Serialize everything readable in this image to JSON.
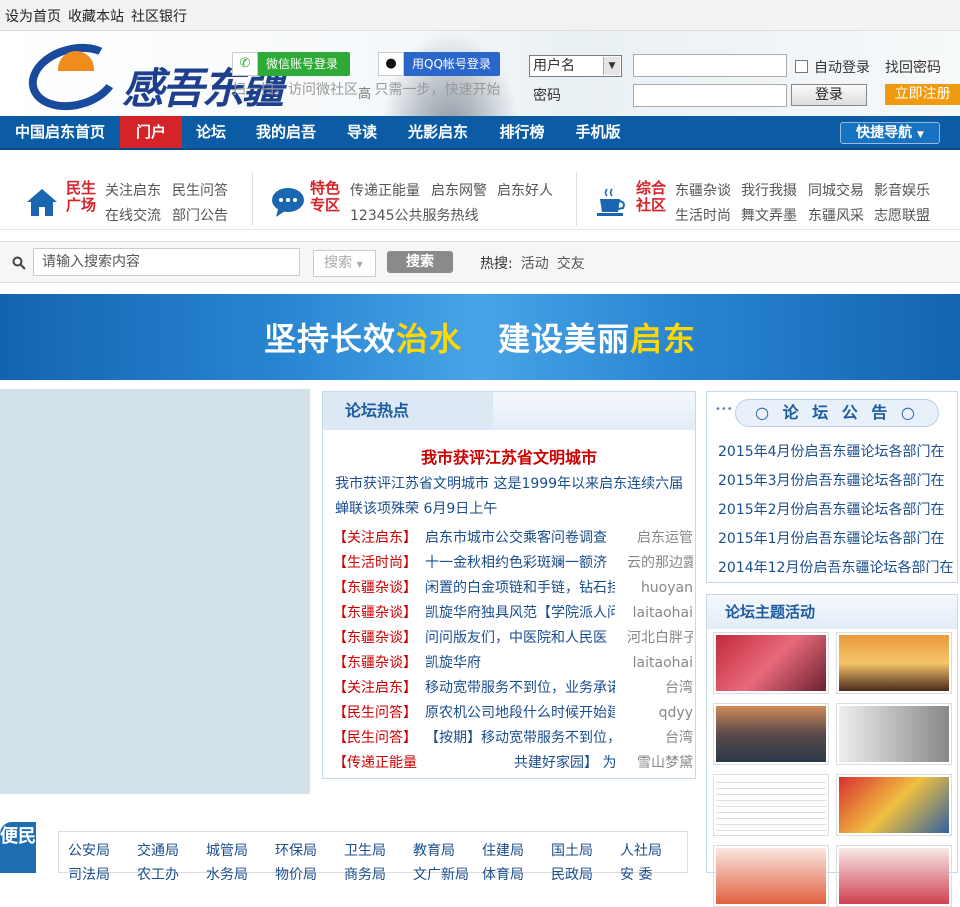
{
  "topbar": {
    "set_home": "设为首页",
    "bookmark": "收藏本站",
    "community_bank": "社区银行"
  },
  "header": {
    "logo_text": "感吾东疆",
    "logo_sub": "高",
    "wechat_login": "微信账号登录",
    "qq_login": "用QQ帐号登录",
    "scan_hint": "扫一扫，访问微社区",
    "one_step": "只需一步，快速开始",
    "username_select": "用户名",
    "password_label": "密码",
    "auto_login": "自动登录",
    "find_password": "找回密码",
    "login_button": "登录",
    "register_button": "立即注册"
  },
  "nav": {
    "items": [
      "中国启东首页",
      "门户",
      "论坛",
      "我的启吾",
      "导读",
      "光影启东",
      "排行榜",
      "手机版"
    ],
    "active": "门户",
    "quick_nav": "快捷导航"
  },
  "categories": [
    {
      "title": "民生广场",
      "icon": "home-icon",
      "links": [
        "关注启东",
        "民生问答",
        "在线交流",
        "部门公告"
      ]
    },
    {
      "title": "特色专区",
      "icon": "chat-bubble-icon",
      "links": [
        "传递正能量",
        "启东网警",
        "启东好人",
        "12345公共服务热线"
      ]
    },
    {
      "title": "综合社区",
      "icon": "coffee-cup-icon",
      "links": [
        "东疆杂谈",
        "我行我摄",
        "同城交易",
        "影音娱乐",
        "生活时尚",
        "舞文弄墨",
        "东疆风采",
        "志愿联盟"
      ]
    }
  ],
  "search": {
    "placeholder": "请输入搜索内容",
    "scope": "搜索",
    "button": "搜索",
    "hot_label": "热搜:",
    "hot_words": [
      "活动",
      "交友"
    ]
  },
  "banner": {
    "part1": "坚持长效",
    "part2": "治水",
    "part3": "建设美丽",
    "part4": "启东"
  },
  "forum_hot": {
    "title": "论坛热点",
    "headline": "我市获评江苏省文明城市",
    "summary": "我市获评江苏省文明城市 这是1999年以来启东连续六届蝉联该项殊荣 6月9日上午",
    "rows": [
      {
        "tag": "【关注启东】",
        "title": "启东市城市公交乘客问卷调查",
        "author": "启东运管"
      },
      {
        "tag": "【生活时尚】",
        "title": "十一金秋相约色彩斑斓一额济",
        "author": "云的那边露"
      },
      {
        "tag": "【东疆杂谈】",
        "title": "闲置的白金项链和手链，钻石挂",
        "author": "huoyan"
      },
      {
        "tag": "【东疆杂谈】",
        "title": "凯旋华府独具风范【学院派人问",
        "author": "laitaohai"
      },
      {
        "tag": "【东疆杂谈】",
        "title": "问问版友们，中医院和人民医",
        "author": "河北白胖子"
      },
      {
        "tag": "【东疆杂谈】",
        "title": "凯旋华府",
        "author": "laitaohai"
      },
      {
        "tag": "【关注启东】",
        "title": "移动宽带服务不到位，业务承诺与服",
        "author": "台湾"
      },
      {
        "tag": "【民生问答】",
        "title": "原农机公司地段什么时候开始建安",
        "author": "qdyy"
      },
      {
        "tag": "【民生问答】",
        "title": "【按期】移动宽带服务不到位，业务",
        "author": "台湾"
      },
      {
        "tag": "【传递正能量",
        "title": "共建好家园】 为病人服务，我",
        "author": "雪山梦黛"
      }
    ]
  },
  "announcements": {
    "title": "论 坛 公 告",
    "items": [
      "2015年4月份启吾东疆论坛各部门在",
      "2015年3月份启吾东疆论坛各部门在",
      "2015年2月份启吾东疆论坛各部门在",
      "2015年1月份启吾东疆论坛各部门在",
      "2014年12月份启吾东疆论坛各部门在"
    ]
  },
  "activities": {
    "title": "论坛主题活动"
  },
  "bianmin": {
    "label": "便民"
  },
  "departments": {
    "row1": [
      "公安局",
      "交通局",
      "城管局",
      "环保局",
      "卫生局",
      "教育局",
      "住建局",
      "国土局",
      "人社局"
    ],
    "row2": [
      "司法局",
      "农工办",
      "水务局",
      "物价局",
      "商务局",
      "文广新局",
      "体育局",
      "民政局",
      "安 委"
    ]
  },
  "colors": {
    "nav": "#0c5ca5",
    "active": "#d4242a",
    "register": "#f09a10",
    "link": "#1a4e8e",
    "tag": "#cc0000"
  }
}
